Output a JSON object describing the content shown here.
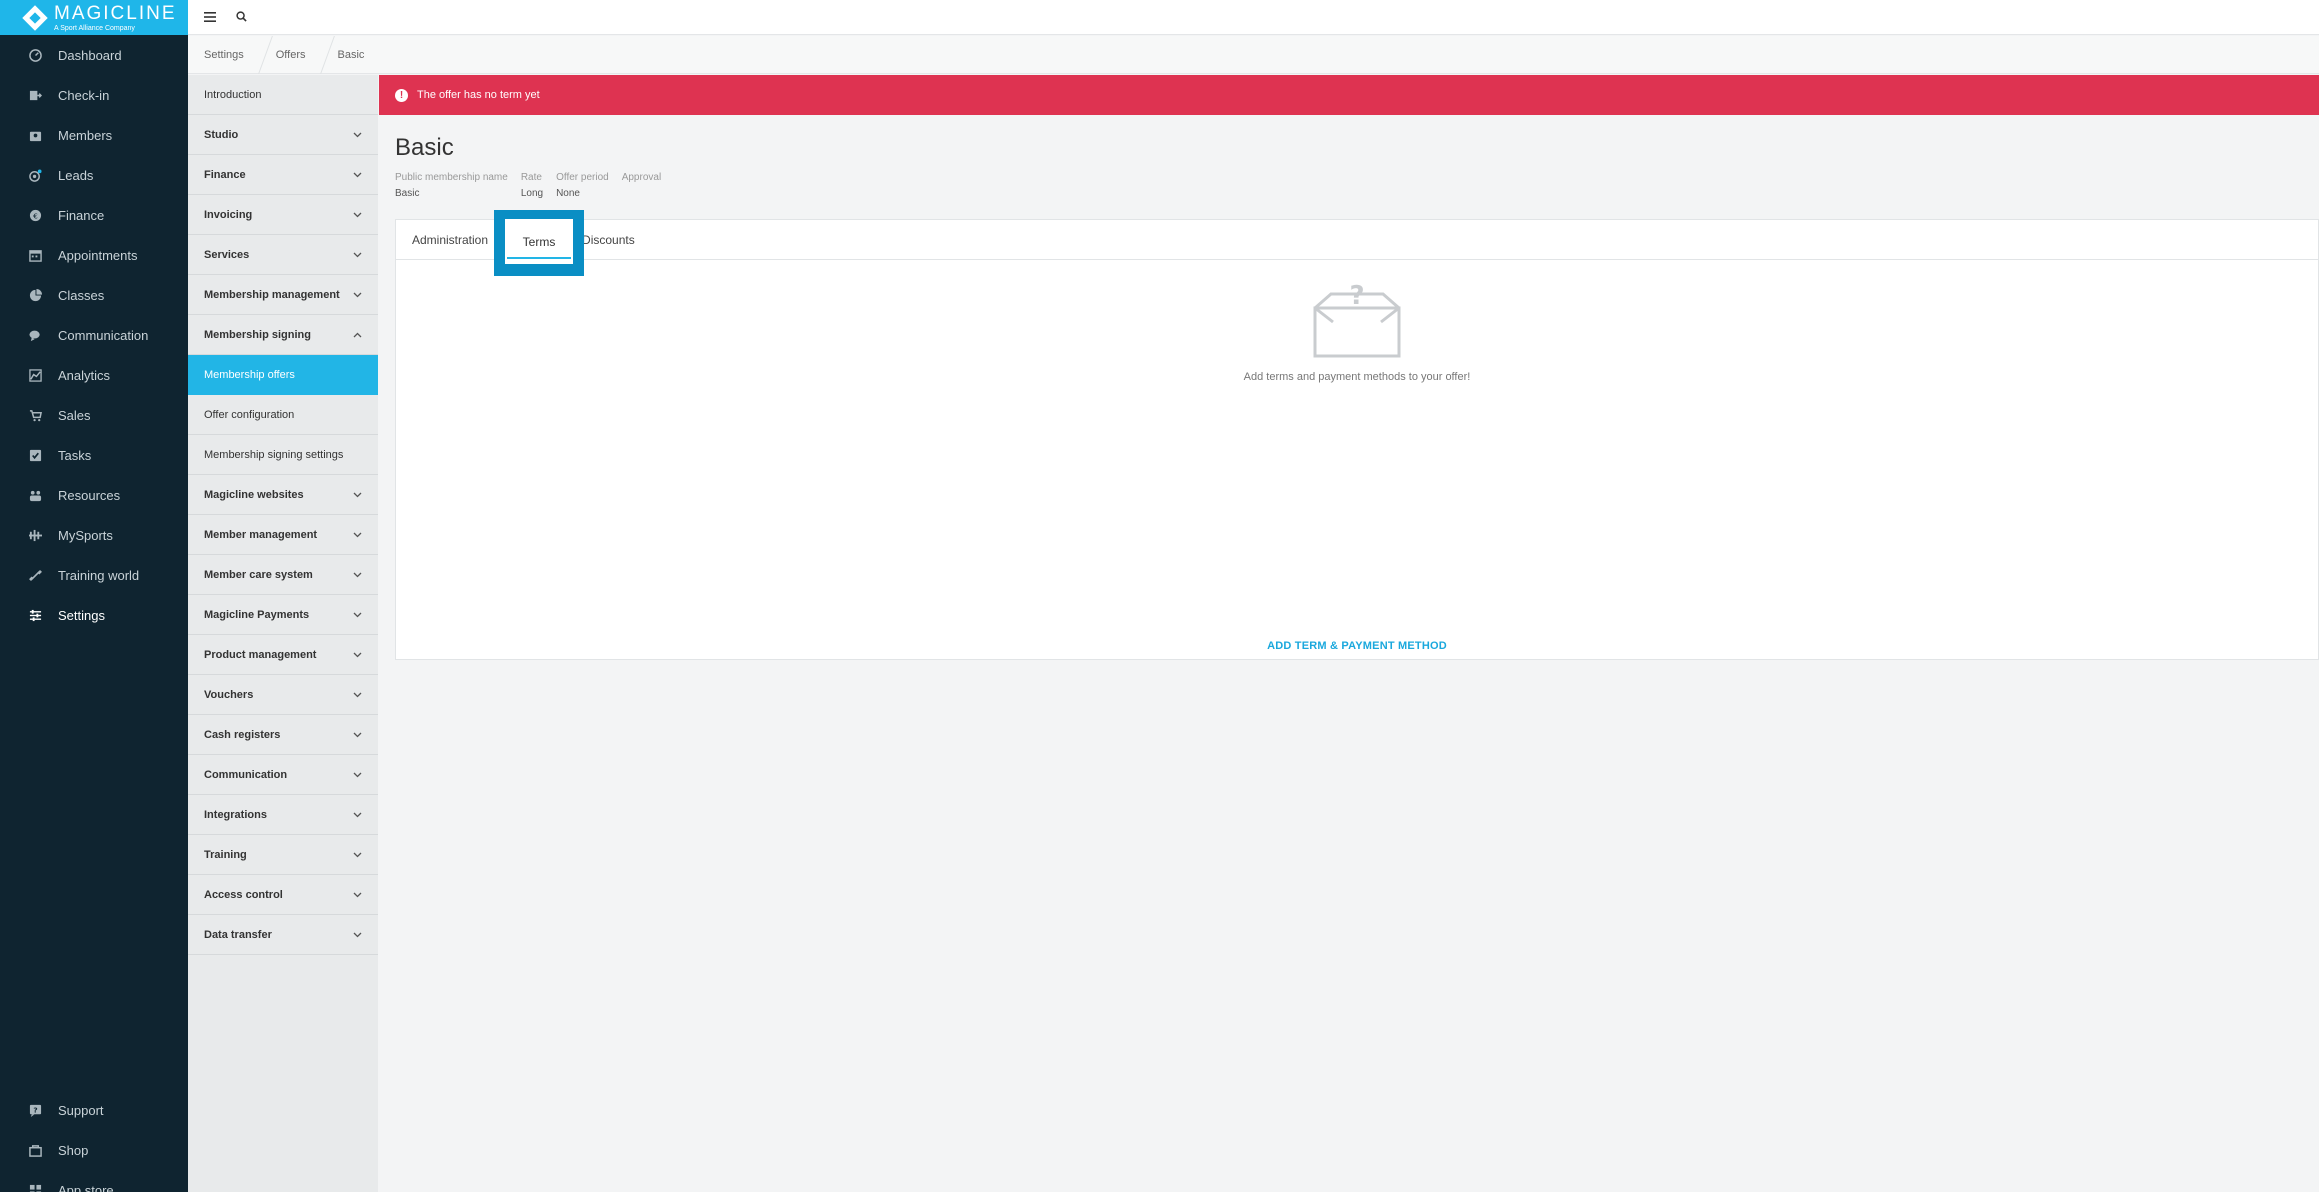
{
  "brand": {
    "name": "MAGICLINE",
    "tagline": "A Sport Alliance Company"
  },
  "sidebar": {
    "items": [
      {
        "label": "Dashboard",
        "icon": "dashboard-icon"
      },
      {
        "label": "Check-in",
        "icon": "checkin-icon"
      },
      {
        "label": "Members",
        "icon": "members-icon"
      },
      {
        "label": "Leads",
        "icon": "leads-icon"
      },
      {
        "label": "Finance",
        "icon": "finance-icon"
      },
      {
        "label": "Appointments",
        "icon": "calendar-icon"
      },
      {
        "label": "Classes",
        "icon": "classes-icon"
      },
      {
        "label": "Communication",
        "icon": "chat-icon"
      },
      {
        "label": "Analytics",
        "icon": "analytics-icon"
      },
      {
        "label": "Sales",
        "icon": "cart-icon"
      },
      {
        "label": "Tasks",
        "icon": "tasks-icon"
      },
      {
        "label": "Resources",
        "icon": "resources-icon"
      },
      {
        "label": "MySports",
        "icon": "mysports-icon"
      },
      {
        "label": "Training world",
        "icon": "dumbbell-icon"
      },
      {
        "label": "Settings",
        "icon": "sliders-icon"
      }
    ],
    "bottom": [
      {
        "label": "Support",
        "icon": "support-icon"
      },
      {
        "label": "Shop",
        "icon": "shop-icon"
      },
      {
        "label": "App store",
        "icon": "appstore-icon"
      }
    ]
  },
  "breadcrumb": [
    "Settings",
    "Offers",
    "Basic"
  ],
  "settings_nav": [
    {
      "label": "Introduction",
      "type": "sub"
    },
    {
      "label": "Studio",
      "type": "group",
      "expanded": false
    },
    {
      "label": "Finance",
      "type": "group",
      "expanded": false
    },
    {
      "label": "Invoicing",
      "type": "group",
      "expanded": false
    },
    {
      "label": "Services",
      "type": "group",
      "expanded": false
    },
    {
      "label": "Membership management",
      "type": "group",
      "expanded": false
    },
    {
      "label": "Membership signing",
      "type": "group",
      "expanded": true
    },
    {
      "label": "Membership offers",
      "type": "sub",
      "selected": true
    },
    {
      "label": "Offer configuration",
      "type": "sub"
    },
    {
      "label": "Membership signing settings",
      "type": "sub"
    },
    {
      "label": "Magicline websites",
      "type": "group",
      "expanded": false
    },
    {
      "label": "Member management",
      "type": "group",
      "expanded": false
    },
    {
      "label": "Member care system",
      "type": "group",
      "expanded": false
    },
    {
      "label": "Magicline Payments",
      "type": "group",
      "expanded": false
    },
    {
      "label": "Product management",
      "type": "group",
      "expanded": false
    },
    {
      "label": "Vouchers",
      "type": "group",
      "expanded": false
    },
    {
      "label": "Cash registers",
      "type": "group",
      "expanded": false
    },
    {
      "label": "Communication",
      "type": "group",
      "expanded": false
    },
    {
      "label": "Integrations",
      "type": "group",
      "expanded": false
    },
    {
      "label": "Training",
      "type": "group",
      "expanded": false
    },
    {
      "label": "Access control",
      "type": "group",
      "expanded": false
    },
    {
      "label": "Data transfer",
      "type": "group",
      "expanded": false
    }
  ],
  "alert": {
    "text": "The offer has no term yet"
  },
  "offer": {
    "title": "Basic",
    "meta": [
      {
        "label": "Public membership name",
        "value": "Basic"
      },
      {
        "label": "Rate",
        "value": "Long"
      },
      {
        "label": "Offer period",
        "value": "None"
      },
      {
        "label": "Approval",
        "value": ""
      }
    ]
  },
  "tabs": [
    {
      "label": "Administration"
    },
    {
      "label": "Terms",
      "active": true
    },
    {
      "label": "Discounts"
    }
  ],
  "empty_state": {
    "text": "Add terms and payment methods to your offer!"
  },
  "add_link": "ADD TERM & PAYMENT METHOD",
  "colors": {
    "brand": "#1fb6e9",
    "alert": "#de3351",
    "selected": "#22b5e6",
    "sidebar": "#0f2430",
    "highlight": "#0a8ec4"
  }
}
